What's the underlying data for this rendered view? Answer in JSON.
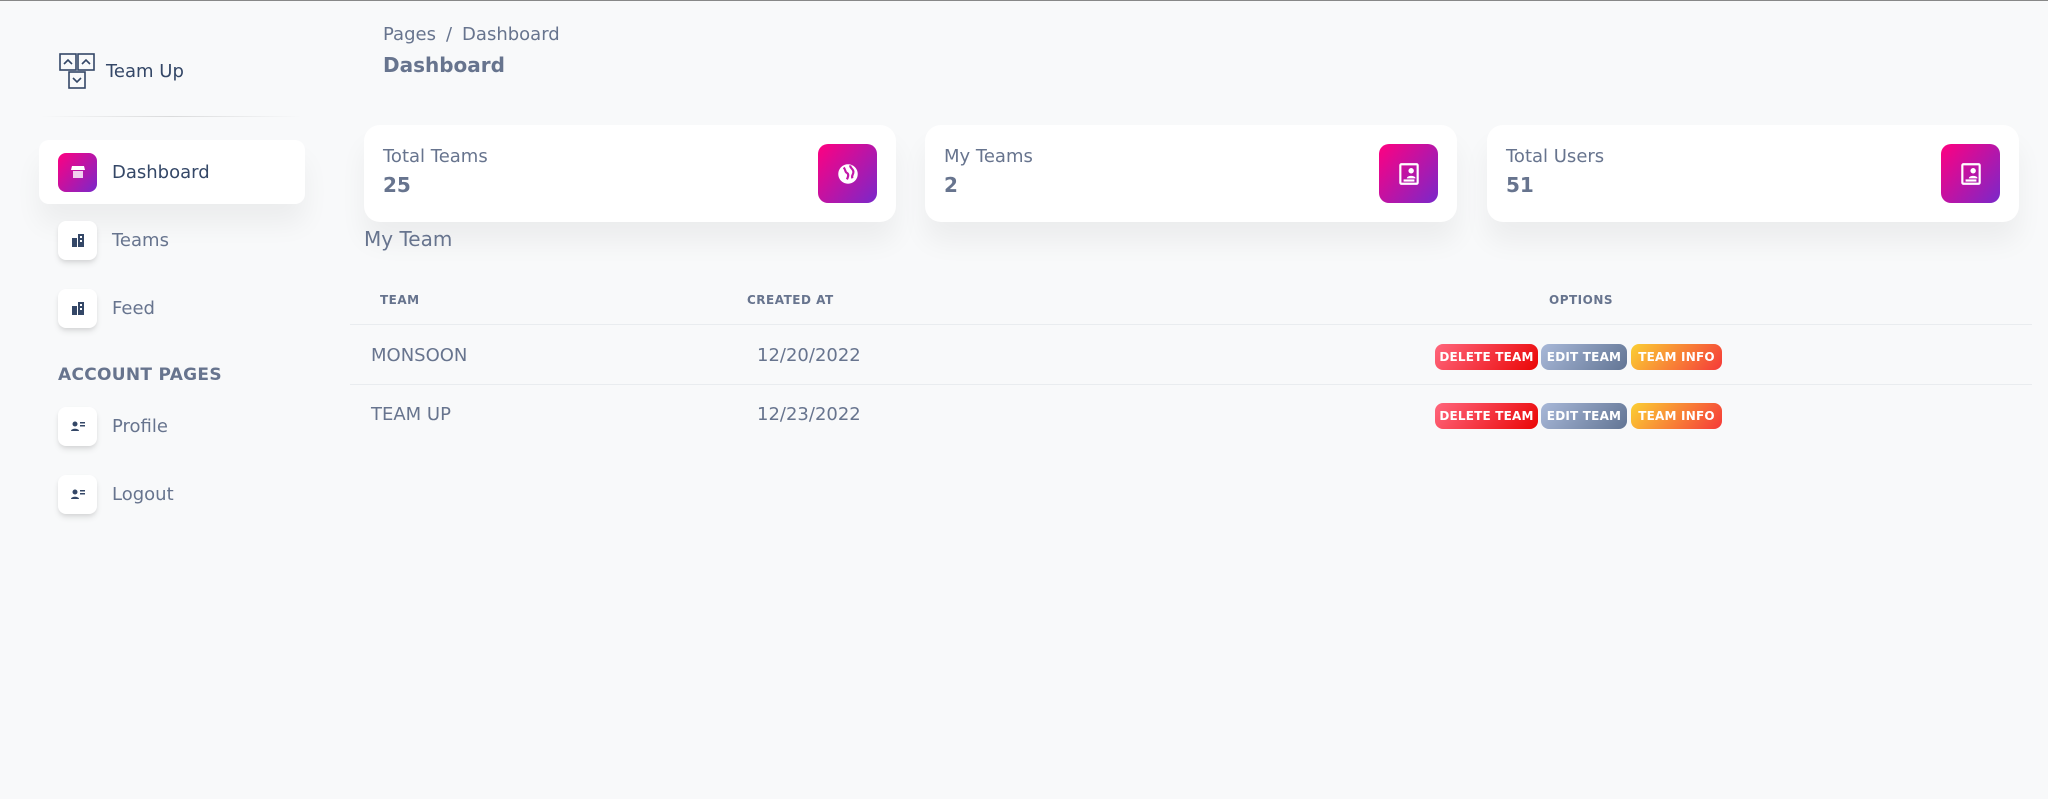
{
  "brand": {
    "name": "Team Up",
    "icon": "team-up-logo-icon"
  },
  "sidebar": {
    "items": [
      {
        "label": "Dashboard",
        "icon": "shop-icon",
        "active": true
      },
      {
        "label": "Teams",
        "icon": "office-icon",
        "active": false
      },
      {
        "label": "Feed",
        "icon": "office-icon",
        "active": false
      }
    ],
    "account_title": "ACCOUNT PAGES",
    "account_items": [
      {
        "label": "Profile",
        "icon": "user-card-icon"
      },
      {
        "label": "Logout",
        "icon": "user-card-icon"
      }
    ]
  },
  "header": {
    "breadcrumb": {
      "root": "Pages",
      "separator": "/",
      "current": "Dashboard"
    },
    "title": "Dashboard"
  },
  "stats": [
    {
      "label": "Total Teams",
      "value": "25",
      "icon": "globe-icon"
    },
    {
      "label": "My Teams",
      "value": "2",
      "icon": "badge-icon"
    },
    {
      "label": "Total Users",
      "value": "51",
      "icon": "badge-icon"
    }
  ],
  "table": {
    "title": "My Team",
    "columns": {
      "team": "TEAM",
      "created_at": "CREATED AT",
      "options": "OPTIONS"
    },
    "rows": [
      {
        "team": "MONSOON",
        "created_at": "12/20/2022"
      },
      {
        "team": "TEAM UP",
        "created_at": "12/23/2022"
      }
    ],
    "actions": {
      "delete": "DELETE TEAM",
      "edit": "EDIT TEAM",
      "info": "TEAM INFO"
    }
  },
  "colors": {
    "accent_gradient_start": "#7928ca",
    "accent_gradient_end": "#ff0080",
    "delete": "#ea0606",
    "edit": "#627594",
    "info": "#fbcf33"
  }
}
